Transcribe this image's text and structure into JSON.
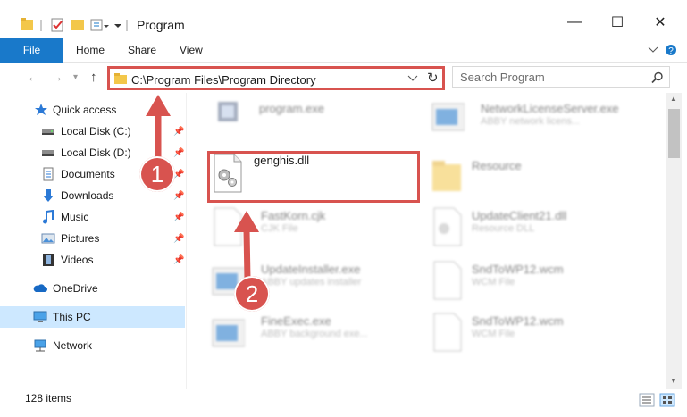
{
  "window": {
    "title": "Program",
    "controls": {
      "minimize": "—",
      "maximize": "☐",
      "close": "✕"
    }
  },
  "ribbon": {
    "tabs": [
      "File",
      "Home",
      "Share",
      "View"
    ],
    "help_icon": "?"
  },
  "address_bar": {
    "path": "C:\\Program Files\\Program Directory",
    "refresh_icon": "↻"
  },
  "search": {
    "placeholder": "Search Program"
  },
  "sidebar": {
    "items": [
      {
        "label": "Quick access",
        "icon": "star-icon",
        "pinned": false
      },
      {
        "label": "Local Disk (C:)",
        "icon": "drive-icon",
        "pinned": true
      },
      {
        "label": "Local Disk (D:)",
        "icon": "drive-icon",
        "pinned": true
      },
      {
        "label": "Documents",
        "icon": "documents-icon",
        "pinned": true
      },
      {
        "label": "Downloads",
        "icon": "download-icon",
        "pinned": true
      },
      {
        "label": "Music",
        "icon": "music-icon",
        "pinned": true
      },
      {
        "label": "Pictures",
        "icon": "pictures-icon",
        "pinned": true
      },
      {
        "label": "Videos",
        "icon": "videos-icon",
        "pinned": true
      },
      {
        "label": "OneDrive",
        "icon": "cloud-icon",
        "pinned": false
      },
      {
        "label": "This PC",
        "icon": "computer-icon",
        "pinned": false
      },
      {
        "label": "Network",
        "icon": "network-icon",
        "pinned": false
      }
    ]
  },
  "files": [
    {
      "name": "program.exe",
      "type": ""
    },
    {
      "name": "NetworkLicenseServer.exe",
      "type": "ABBY network licens..."
    },
    {
      "name": "genghis.dll",
      "type": ""
    },
    {
      "name": "Resource",
      "type": ""
    },
    {
      "name": "FastKorn.cjk",
      "type": "CJK File"
    },
    {
      "name": "UpdateClient21.dll",
      "type": "Resource DLL"
    },
    {
      "name": "UpdateInstaller.exe",
      "type": "ABBY updates installer"
    },
    {
      "name": "SndToWP12.wcm",
      "type": "WCM File"
    },
    {
      "name": "FineExec.exe",
      "type": "ABBY background exe..."
    },
    {
      "name": "SndToWP12.wcm",
      "type": "WCM File"
    }
  ],
  "status": {
    "item_count": "128 items"
  },
  "annotations": {
    "step1": "1",
    "step2": "2"
  },
  "colors": {
    "accent": "#1979ca",
    "highlight": "#d8534f",
    "selected": "#cde8ff"
  }
}
